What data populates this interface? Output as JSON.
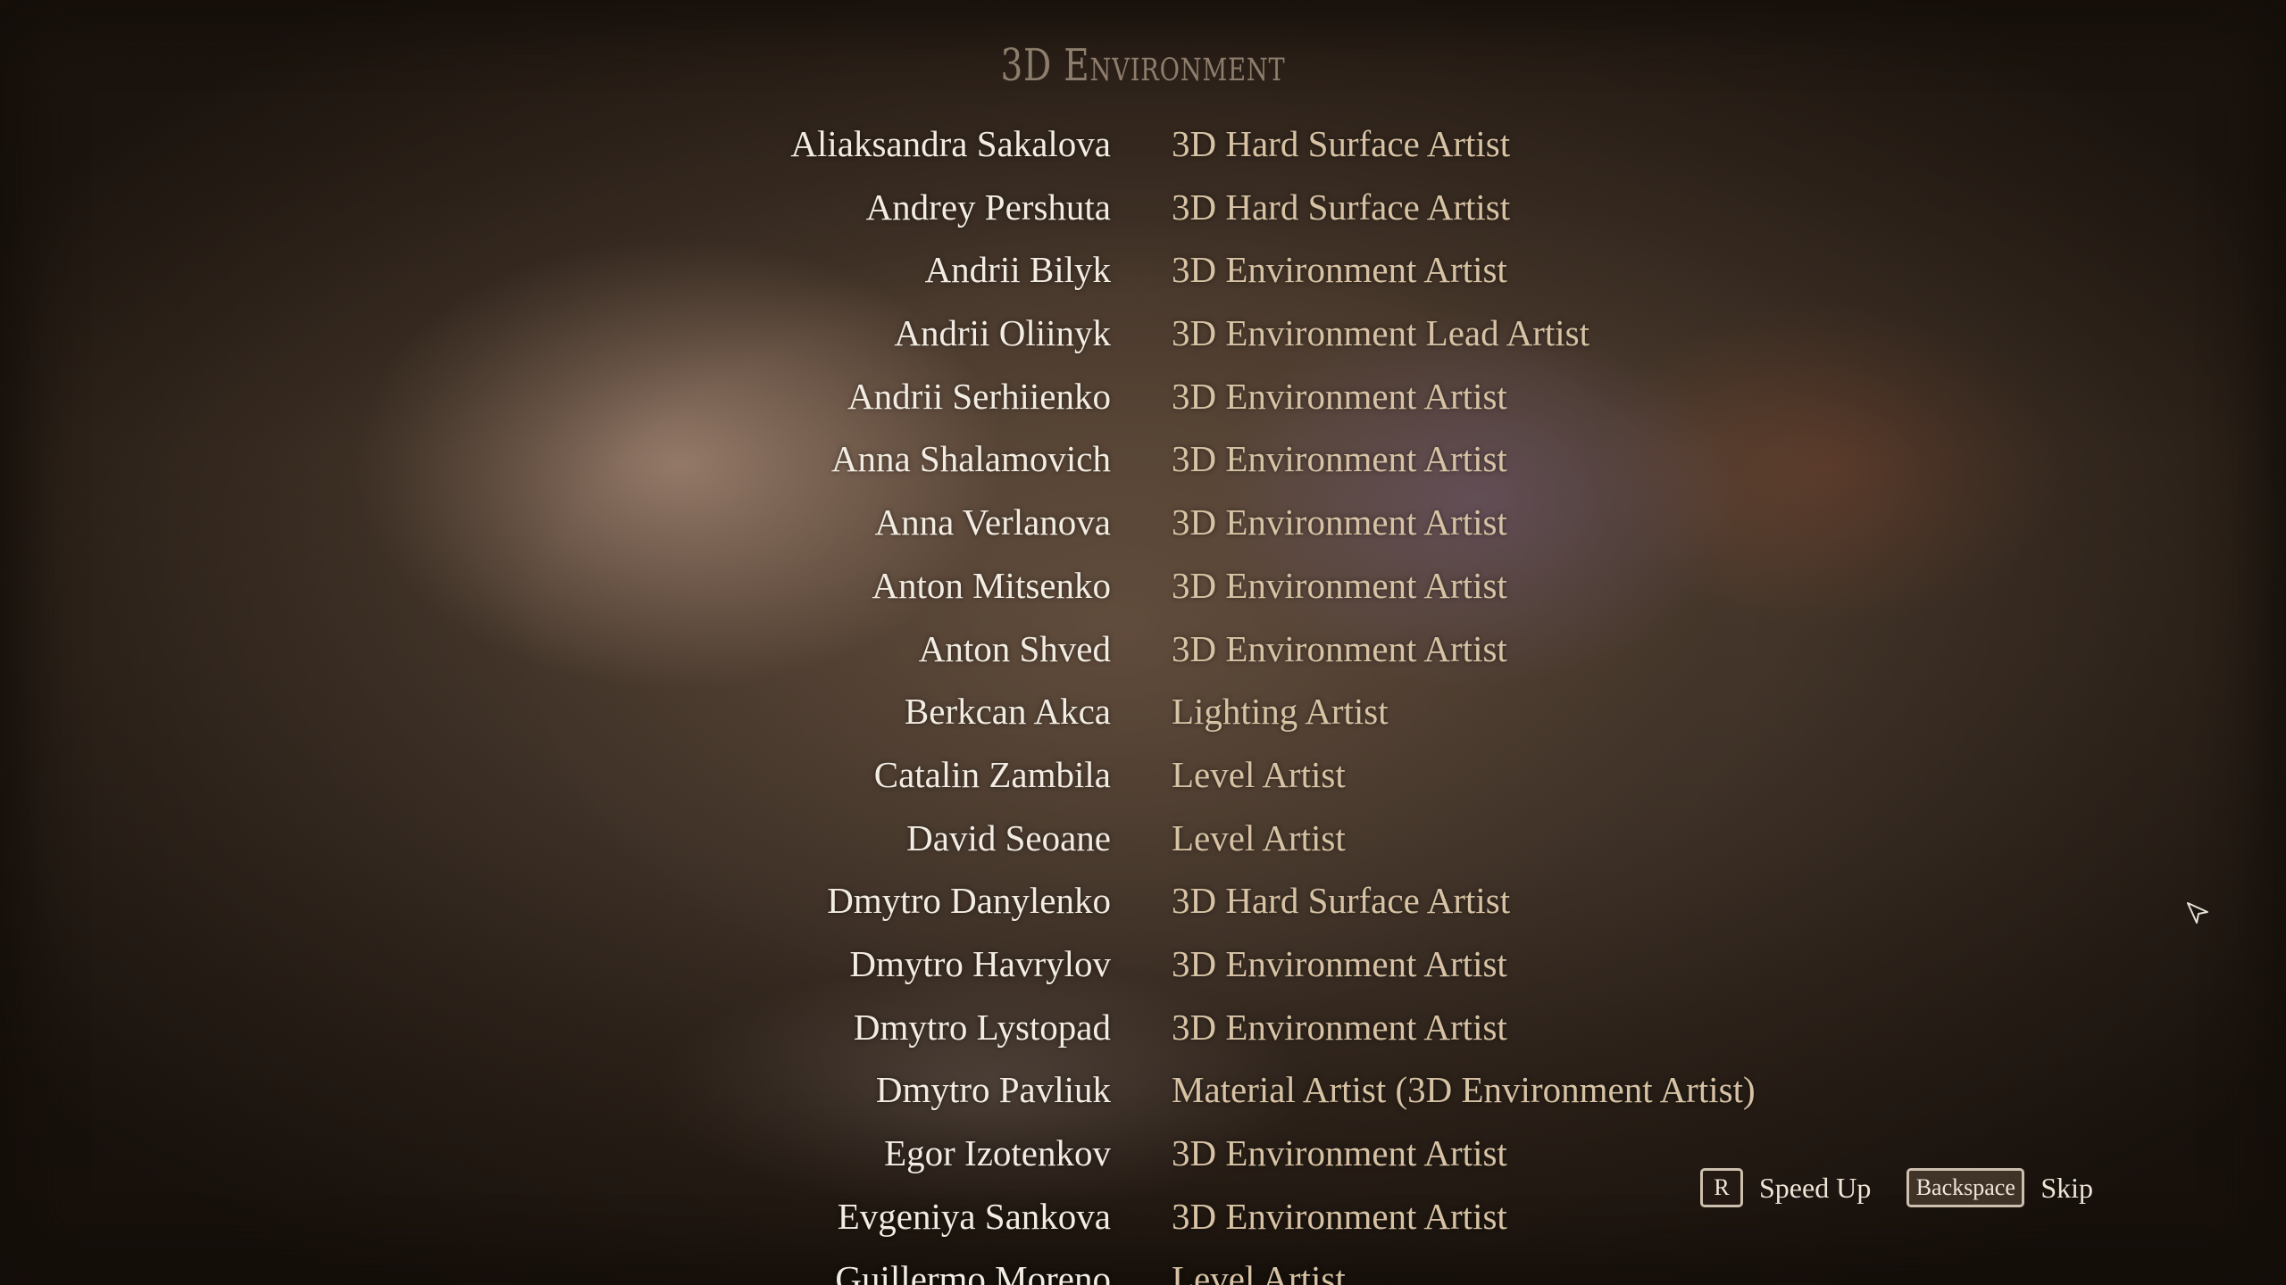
{
  "section_title": "3D Environment",
  "credits": [
    {
      "name": "Aliaksandra Sakalova",
      "role": "3D Hard Surface Artist"
    },
    {
      "name": "Andrey Pershuta",
      "role": "3D Hard Surface Artist"
    },
    {
      "name": "Andrii Bilyk",
      "role": "3D Environment Artist"
    },
    {
      "name": "Andrii Oliinyk",
      "role": "3D Environment Lead Artist"
    },
    {
      "name": "Andrii Serhiienko",
      "role": "3D Environment Artist"
    },
    {
      "name": "Anna Shalamovich",
      "role": "3D Environment Artist"
    },
    {
      "name": "Anna Verlanova",
      "role": "3D Environment Artist"
    },
    {
      "name": "Anton Mitsenko",
      "role": "3D Environment Artist"
    },
    {
      "name": "Anton Shved",
      "role": "3D Environment Artist"
    },
    {
      "name": "Berkcan Akca",
      "role": "Lighting Artist"
    },
    {
      "name": "Catalin Zambila",
      "role": "Level Artist"
    },
    {
      "name": "David Seoane",
      "role": "Level Artist"
    },
    {
      "name": "Dmytro Danylenko",
      "role": "3D Hard Surface Artist"
    },
    {
      "name": "Dmytro Havrylov",
      "role": "3D Environment Artist"
    },
    {
      "name": "Dmytro Lystopad",
      "role": "3D Environment Artist"
    },
    {
      "name": "Dmytro Pavliuk",
      "role": "Material Artist (3D Environment Artist)"
    },
    {
      "name": "Egor Izotenkov",
      "role": "3D Environment Artist"
    },
    {
      "name": "Evgeniya Sankova",
      "role": "3D Environment Artist"
    },
    {
      "name": "Guillermo Moreno",
      "role": "Level Artist"
    }
  ],
  "controls": {
    "speed_key": "R",
    "speed_label": "Speed Up",
    "skip_key": "Backspace",
    "skip_label": "Skip"
  },
  "icons": {
    "cursor": "mouse-pointer-icon"
  },
  "colors": {
    "name_text": "#f3ece2",
    "role_text": "#d7c2a4",
    "title_text": "#8d7d6c"
  }
}
